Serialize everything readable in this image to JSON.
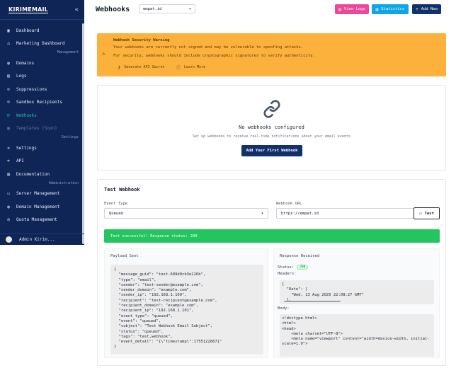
{
  "sidebar": {
    "logo": "KIRIMEMAIL",
    "items": [
      {
        "label": "Dashboard",
        "icon": "dashboard-icon"
      },
      {
        "label": "Marketing Dashboard",
        "icon": "home-icon"
      },
      {
        "section": "Management"
      },
      {
        "label": "Domains",
        "icon": "globe-icon"
      },
      {
        "label": "Logs",
        "icon": "file-icon"
      },
      {
        "label": "Suppressions",
        "icon": "ban-icon"
      },
      {
        "label": "Sandbox Recipients",
        "icon": "users-icon"
      },
      {
        "label": "Webhooks",
        "icon": "webhook-icon",
        "active": true
      },
      {
        "label": "Templates (Soon)",
        "icon": "template-icon",
        "disabled": true
      },
      {
        "section": "Settings"
      },
      {
        "label": "Settings",
        "icon": "gear-icon"
      },
      {
        "label": "API",
        "icon": "api-icon"
      },
      {
        "label": "Documentation",
        "icon": "book-icon"
      },
      {
        "section": "Administration"
      },
      {
        "label": "Server Management",
        "icon": "server-icon"
      },
      {
        "label": "Domain Management",
        "icon": "globe-icon"
      },
      {
        "label": "Quota Management",
        "icon": "quota-icon"
      }
    ],
    "user_name": "Admin Kirim..."
  },
  "header": {
    "title": "Webhooks",
    "domain_select": "empat.id",
    "view_logs": "View Logs",
    "statistics": "Statistics",
    "add_new": "Add New"
  },
  "warning": {
    "title": "Webhook Security Warning",
    "line1": "Your webhooks are currently not signed and may be vulnerable to spoofing attacks.",
    "line2": "For security, webhooks should include cryptographic signatures to verify authenticity.",
    "generate": "Generate API Secret",
    "learn_more": "Learn More"
  },
  "empty": {
    "title": "No webhooks configured",
    "subtitle": "Set up webhooks to receive real-time notifications about your email events",
    "button": "Add Your First Webhook"
  },
  "test": {
    "title": "Test Webhook",
    "event_type_label": "Event Type",
    "event_type_value": "Queued",
    "url_label": "Webhook URL",
    "url_value": "https://empat.id",
    "test_button": "Test",
    "success": "Test successful! Response status: 200",
    "payload_title": "Payload Sent",
    "payload": "{\n  \"message_guid\": \"test-609d0cb3e226b\",\n  \"type\": \"email\",\n  \"sender\": \"test-sender@example.com\",\n  \"sender_domain\": \"example.com\",\n  \"sender_ip\": \"192.168.1.100\",\n  \"recipient\": \"test-recipient@example.com\",\n  \"recipient_domain\": \"example.com\",\n  \"recipient_ip\": \"192.168.1.101\",\n  \"event_type\": \"queued\",\n  \"event\": \"queued\",\n  \"subject\": \"Test Webhook Email Subject\",\n  \"status\": \"queued\",\n  \"tags\": \"test,webhook\",\n  \"event_detail\": \"{\\\"timestamp\\\":1755122867}\"\n}",
    "response_title": "Response Received",
    "status_label": "Status:",
    "status_value": "200",
    "headers_label": "Headers:",
    "headers": "{\n  \"Date\": [\n    \"Wed, 13 Aug 2025 22:08:27 GMT\"\n  ],",
    "body_label": "Body:",
    "body": "<!doctype html>\n<html>\n<head>\n    <meta charset=\"UTF-8\">\n    <meta name=\"viewport\" content=\"width=device-width, initial-scale=1.0\">"
  }
}
